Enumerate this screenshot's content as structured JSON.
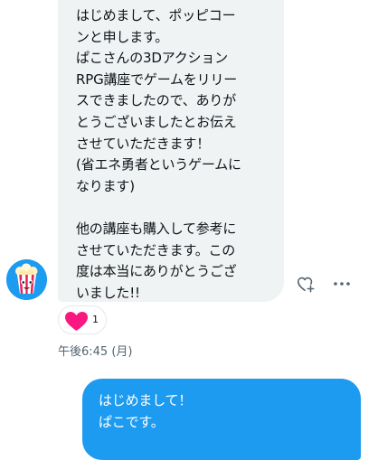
{
  "incoming_message": {
    "lines": [
      "はじめまして、ポッピコー",
      "ンと申します。",
      "ぱこさんの3Dアクション",
      "RPG講座でゲームをリリー",
      "スできましたので、ありが",
      "とうございましたとお伝え",
      "させていただきます！",
      "(省エネ勇者というゲームに",
      "なります)",
      "",
      "他の講座も購入して参考に",
      "させていただきます。この",
      "度は本当にありがとうござ",
      "いました!!"
    ],
    "reaction": {
      "emoji": "heart",
      "count": "1",
      "color": "#f91880"
    },
    "timestamp": "午後6:45 (月)"
  },
  "actions": {
    "react_icon": "heart-plus-icon",
    "more_icon": "more-icon"
  },
  "outgoing_message": {
    "lines": [
      "はじめまして！",
      "ぱこです。"
    ]
  },
  "colors": {
    "incoming_bubble": "#eff3f4",
    "outgoing_bubble": "#1d9bf0",
    "timestamp": "#536471",
    "icon": "#536471"
  }
}
